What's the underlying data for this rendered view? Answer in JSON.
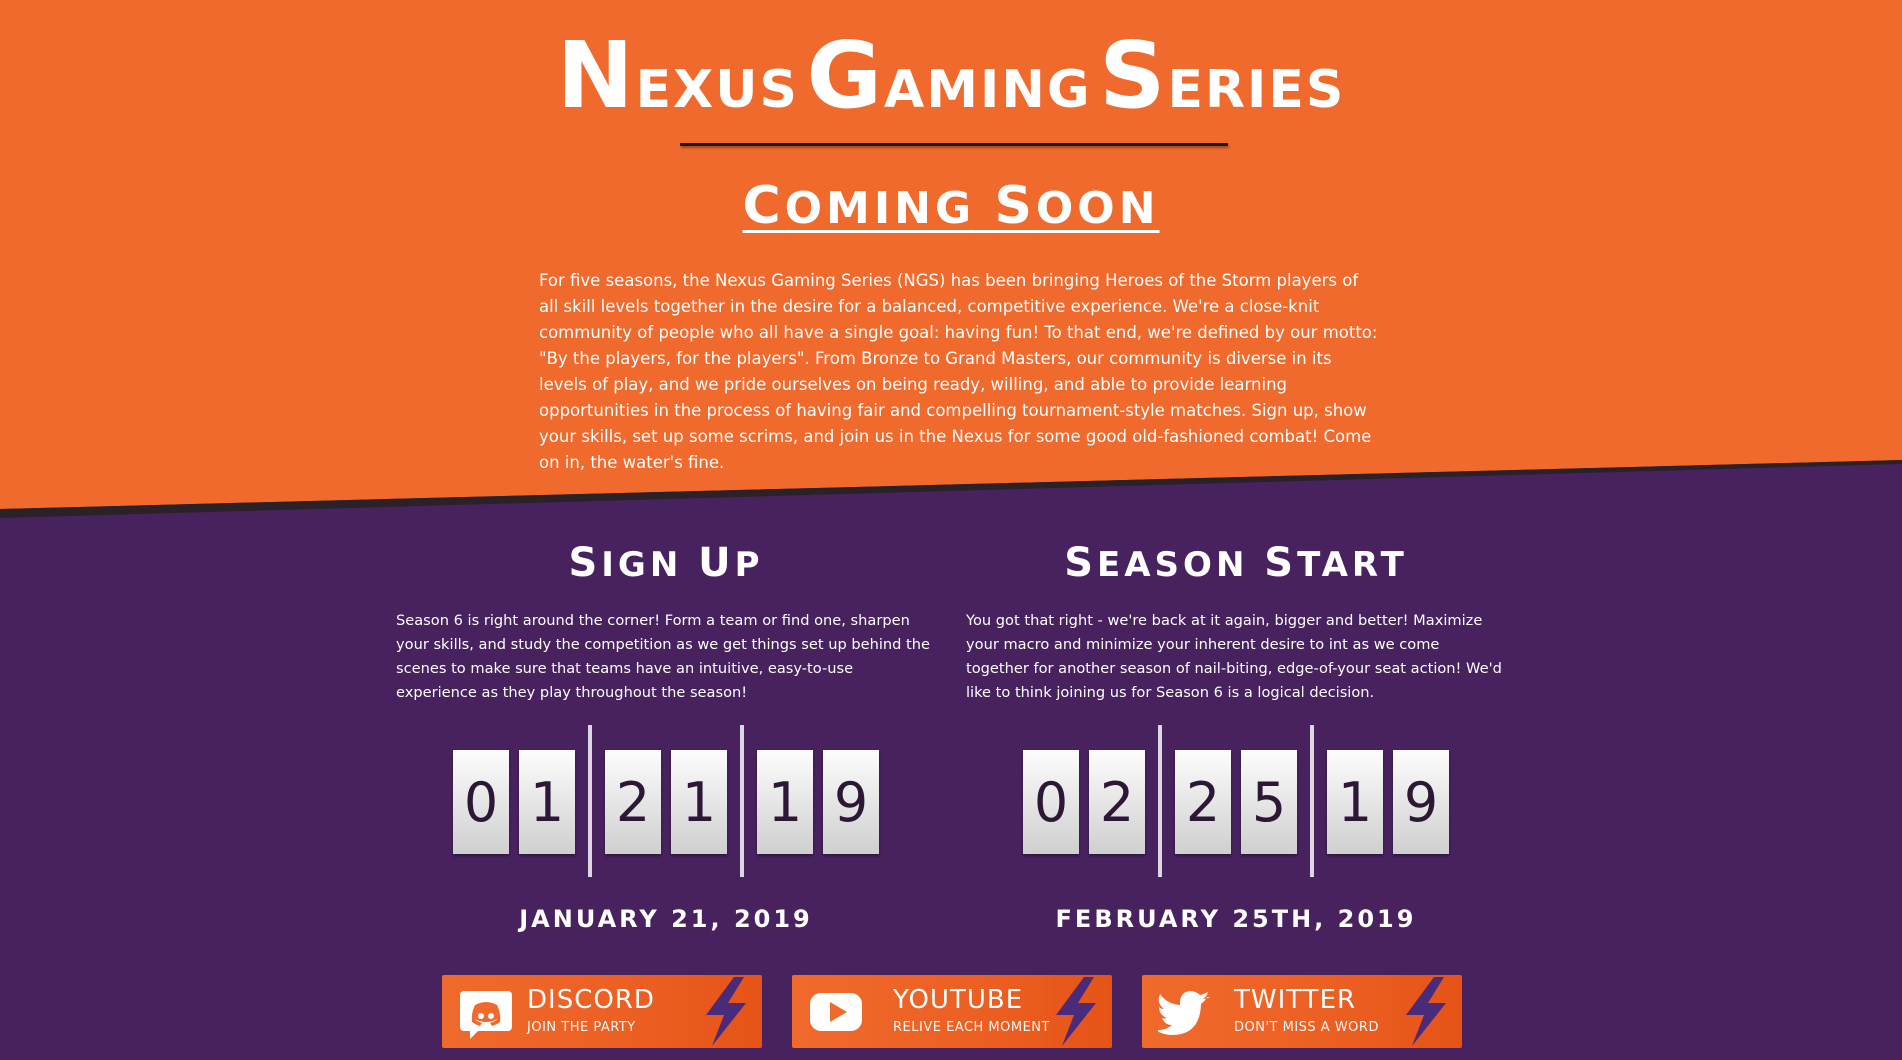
{
  "brand": {
    "w1_cap": "N",
    "w1_rest": "EXUS",
    "w2_cap": "G",
    "w2_rest": "AMING",
    "w3_cap": "S",
    "w3_rest": "ERIES"
  },
  "coming_soon": {
    "c1_cap": "C",
    "c1_rest": "OMING",
    "c2_cap": "S",
    "c2_rest": "OON"
  },
  "intro_text": "For five seasons, the Nexus Gaming Series (NGS) has been bringing Heroes of the Storm players of all skill levels together in the desire for a balanced, competitive experience. We're a close-knit community of people who all have a single goal: having fun! To that end, we're defined by our motto: \"By the players, for the players\". From Bronze to Grand Masters, our community is diverse in its levels of play, and we pride ourselves on being ready, willing, and able to provide learning opportunities in the process of having fair and compelling tournament-style matches. Sign up, show your skills, set up some scrims, and join us in the Nexus for some good old-fashioned combat! Come on in, the water's fine.",
  "signup": {
    "h_cap1": "S",
    "h_rest1": "IGN",
    "h_cap2": "U",
    "h_rest2": "P",
    "text": "Season 6 is right around the corner! Form a team or find one, sharpen your skills, and study the competition as we get things set up behind the scenes to make sure that teams have an intuitive, easy-to-use experience as they play throughout the season!",
    "digits": [
      "0",
      "1",
      "2",
      "1",
      "1",
      "9"
    ],
    "date": "JANUARY 21, 2019"
  },
  "season": {
    "h_cap1": "S",
    "h_rest1": "EASON",
    "h_cap2": "S",
    "h_rest2": "TART",
    "text": "You got that right - we're back at it again, bigger and better! Maximize your macro and minimize your inherent desire to int as we come together for another season of nail-biting, edge-of-your seat action! We'd like to think joining us for Season 6 is a logical decision.",
    "digits": [
      "0",
      "2",
      "2",
      "5",
      "1",
      "9"
    ],
    "date": "FEBRUARY 25TH, 2019"
  },
  "social": {
    "discord": {
      "name": "DISCORD",
      "tagline": "JOIN THE PARTY",
      "icon": "discord-icon"
    },
    "youtube": {
      "name": "YOUTUBE",
      "tagline": "RELIVE EACH MOMENT",
      "icon": "youtube-icon"
    },
    "twitter": {
      "name": "TWITTER",
      "tagline": "DON'T MISS A WORD",
      "icon": "twitter-icon"
    }
  },
  "colors": {
    "orange": "#f06a2d",
    "purple": "#48225f",
    "white": "#ffffff",
    "bolt_purple": "#4a2a7a"
  }
}
